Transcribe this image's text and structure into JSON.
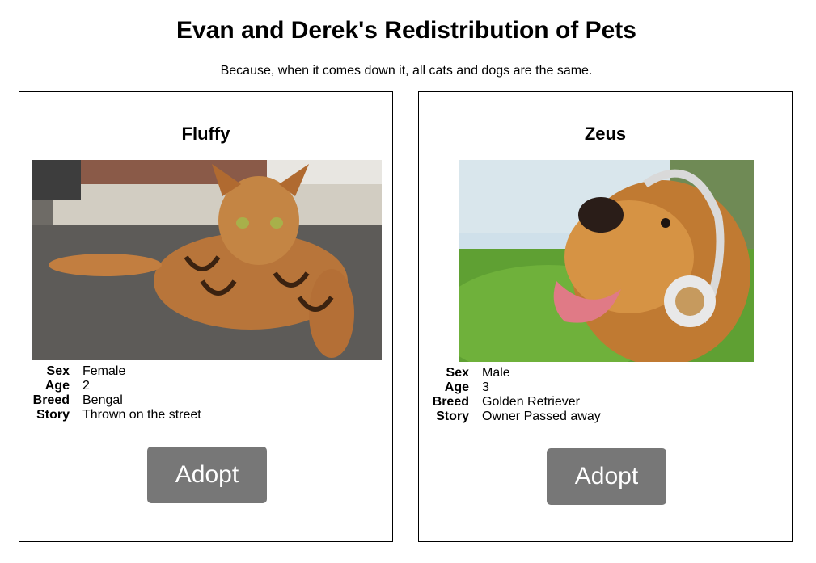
{
  "header": {
    "title": "Evan and Derek's Redistribution of Pets",
    "tagline": "Because, when it comes down it, all cats and dogs are the same."
  },
  "labels": {
    "sex": "Sex",
    "age": "Age",
    "breed": "Breed",
    "story": "Story"
  },
  "pets": [
    {
      "name": "Fluffy",
      "photo_icon": "bengal-cat-photo",
      "sex": "Female",
      "age": "2",
      "breed": "Bengal",
      "story": "Thrown on the street",
      "adopt_label": "Adopt"
    },
    {
      "name": "Zeus",
      "photo_icon": "golden-retriever-headphones-photo",
      "sex": "Male",
      "age": "3",
      "breed": "Golden Retriever",
      "story": "Owner Passed away",
      "adopt_label": "Adopt"
    }
  ],
  "colors": {
    "button_bg": "#777777",
    "button_text": "#ffffff",
    "border": "#000000"
  }
}
